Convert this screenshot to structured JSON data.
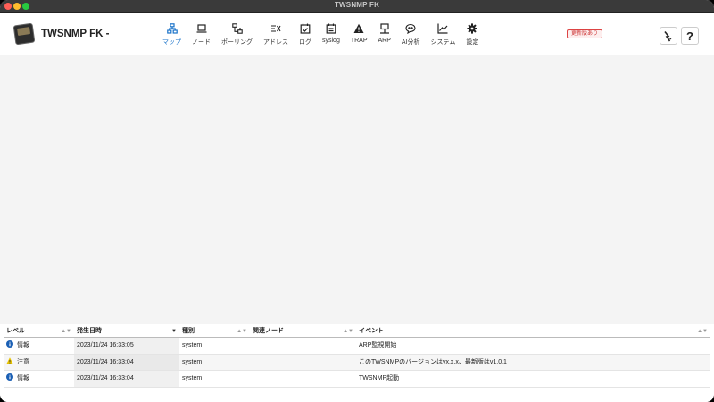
{
  "window": {
    "title": "TWSNMP FK"
  },
  "app": {
    "title": "TWSNMP FK -"
  },
  "nav": [
    {
      "label": "マップ",
      "icon": "map-icon",
      "active": true
    },
    {
      "label": "ノード",
      "icon": "laptop-icon"
    },
    {
      "label": "ポーリング",
      "icon": "polling-icon"
    },
    {
      "label": "アドレス",
      "icon": "address-icon"
    },
    {
      "label": "ログ",
      "icon": "calendar-check-icon"
    },
    {
      "label": "syslog",
      "icon": "calendar-list-icon"
    },
    {
      "label": "TRAP",
      "icon": "warning-triangle-icon"
    },
    {
      "label": "ARP",
      "icon": "network-icon"
    },
    {
      "label": "AI分析",
      "icon": "brain-icon"
    },
    {
      "label": "システム",
      "icon": "chart-line-icon"
    },
    {
      "label": "設定",
      "icon": "gear-icon"
    }
  ],
  "update_badge": "更新版あり",
  "help_label": "?",
  "log": {
    "columns": [
      "レベル",
      "発生日時",
      "種別",
      "関連ノード",
      "イベント"
    ],
    "rows": [
      {
        "level": "情報",
        "level_icon": "info-icon",
        "time": "2023/11/24 16:33:05",
        "type": "system",
        "node": "",
        "event": "ARP監視開始"
      },
      {
        "level": "注意",
        "level_icon": "warning-icon",
        "time": "2023/11/24 16:33:04",
        "type": "system",
        "node": "",
        "event": "このTWSNMPのバージョンはvx.x.x、最新版はv1.0.1"
      },
      {
        "level": "情報",
        "level_icon": "info-icon",
        "time": "2023/11/24 16:33:04",
        "type": "system",
        "node": "",
        "event": "TWSNMP起動"
      }
    ]
  },
  "colors": {
    "accent": "#1a73c9",
    "info": "#1a5fb4",
    "warning": "#e5c100",
    "badge": "#cc3333"
  }
}
